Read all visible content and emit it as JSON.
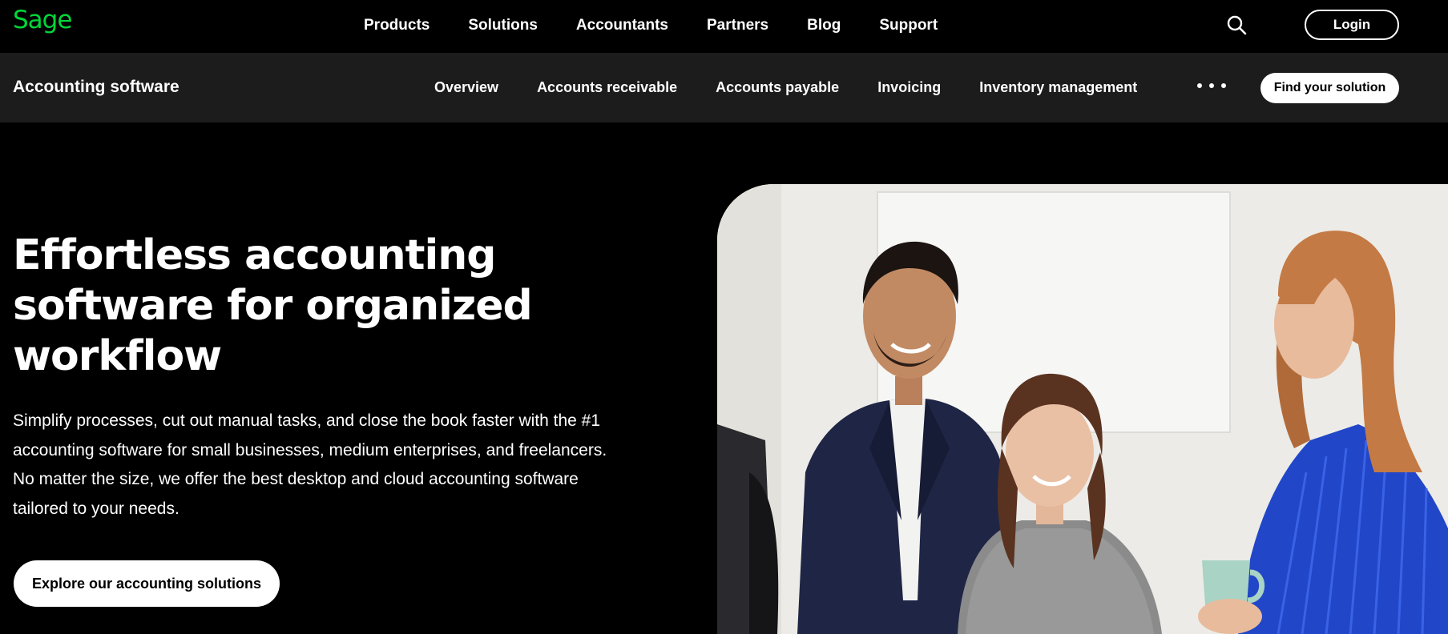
{
  "brand": {
    "logo_text": "Sage",
    "accent_color": "#00d639"
  },
  "topnav": {
    "items": [
      "Products",
      "Solutions",
      "Accountants",
      "Partners",
      "Blog",
      "Support"
    ],
    "search_icon": "search-icon",
    "login_label": "Login"
  },
  "subnav": {
    "title": "Accounting software",
    "items": [
      "Overview",
      "Accounts receivable",
      "Accounts payable",
      "Invoicing",
      "Inventory management"
    ],
    "more_icon": "more-dots-icon",
    "cta_label": "Find your solution"
  },
  "hero": {
    "title_lines": [
      "Effortless accounting",
      "software for organized",
      "workflow"
    ],
    "description_lines": [
      "Simplify processes, cut out manual tasks, and close the book faster with the #1",
      "accounting software for small businesses, medium enterprises, and freelancers.",
      "No matter the size, we offer the best desktop and cloud accounting software",
      "tailored to your needs."
    ],
    "cta_label": "Explore our accounting solutions"
  },
  "colors": {
    "background": "#000000",
    "subnav_background": "#1c1c1c",
    "text": "#ffffff"
  }
}
